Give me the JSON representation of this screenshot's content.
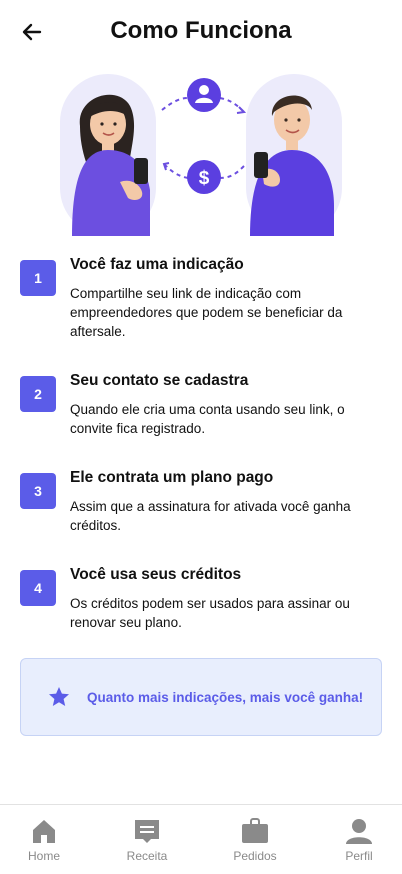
{
  "header": {
    "title": "Como Funciona",
    "back_icon": "arrow-left-icon"
  },
  "illustration": {
    "icons": [
      "user-icon",
      "dollar-icon"
    ],
    "accent": "#5B5CE8"
  },
  "steps": [
    {
      "number": "1",
      "title": "Você faz uma indicação",
      "description": "Compartilhe seu link de indicação com empreendedores que podem se beneficiar da aftersale."
    },
    {
      "number": "2",
      "title": "Seu contato se cadastra",
      "description": "Quando ele cria uma conta usando seu link, o convite fica registrado."
    },
    {
      "number": "3",
      "title": "Ele contrata um plano pago",
      "description": "Assim que a assinatura for ativada você ganha créditos."
    },
    {
      "number": "4",
      "title": "Você usa seus créditos",
      "description": "Os créditos podem ser usados para assinar ou renovar seu plano."
    }
  ],
  "tip": {
    "icon": "star-icon",
    "text": "Quanto mais indicações, mais você ganha!"
  },
  "tabbar": {
    "items": [
      {
        "label": "Home",
        "icon": "home-icon"
      },
      {
        "label": "Receita",
        "icon": "receipt-icon"
      },
      {
        "label": "Pedidos",
        "icon": "bag-icon"
      },
      {
        "label": "Perfil",
        "icon": "person-icon"
      }
    ]
  },
  "colors": {
    "accent": "#5B5CE8",
    "tip_background": "#E8EEFD",
    "tab_inactive": "#8a8a8a"
  }
}
